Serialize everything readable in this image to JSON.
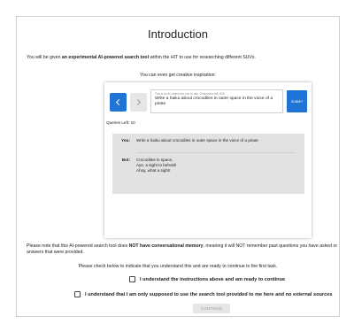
{
  "page": {
    "title": "Introduction",
    "intro": {
      "prefix": "You will be given ",
      "bold": "an experimental AI-powered search tool",
      "suffix": " within the HIT to use for researching different SUVs."
    },
    "inspiration": "You can even get creative inspiration:"
  },
  "demo": {
    "hint": "This is an AI chatbot for you to use. Characters left: 836",
    "query": "Write a haiku about crocodiles in outer space in the voice of a pirate",
    "submit_label": "SUBMIT",
    "queries_left": "Queries Left: 10",
    "user_label": "You:",
    "user_message": "Write a haiku about crocodiles in outer space in the voice of a pirate",
    "bot_label": "Bot:",
    "bot_lines": [
      "Crocodiles in space,",
      "Aye, a sight to behold!",
      "Ahoy, what a sight!"
    ]
  },
  "note": {
    "prefix": "Please note that this AI-powered search tool does ",
    "bold": "NOT have conversational memory",
    "suffix": ", meaning it will NOT remember past questions you have asked or answers that were provided."
  },
  "check_instruction": "Please check below to indicate that you understand this and are ready to continue to the first task.",
  "checkboxes": [
    {
      "label": "I understand the instructions above and am ready to continue",
      "checked": false
    },
    {
      "label": "I understand that I am only supposed to use the search tool provided to me here and no external sources",
      "checked": false
    }
  ],
  "continue_label": "CONTINUE",
  "colors": {
    "accent": "#1f74d6",
    "disabled": "#e6e6e6"
  }
}
